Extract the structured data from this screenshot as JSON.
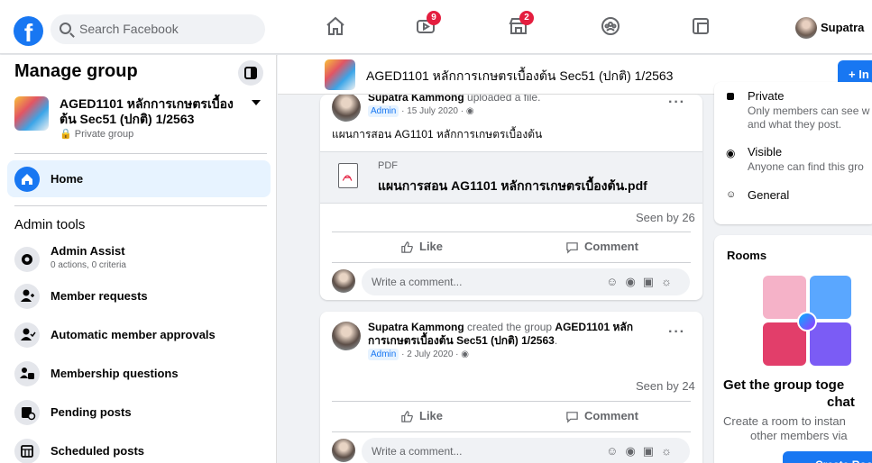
{
  "topbar": {
    "search_placeholder": "Search Facebook",
    "watch_badge": "9",
    "marketplace_badge": "2",
    "profile_name": "Supatra"
  },
  "sidebar": {
    "title": "Manage group",
    "group_name": "AGED1101 หลักการเกษตรเบื้องต้น Sec51 (ปกติ) 1/2563",
    "group_privacy": "Private group",
    "home_label": "Home",
    "section_title": "Admin tools",
    "items": [
      {
        "label": "Admin Assist",
        "sub": "0 actions, 0 criteria"
      },
      {
        "label": "Member requests"
      },
      {
        "label": "Automatic member approvals"
      },
      {
        "label": "Membership questions"
      },
      {
        "label": "Pending posts"
      },
      {
        "label": "Scheduled posts"
      }
    ]
  },
  "group_header": {
    "title": "AGED1101 หลักการเกษตรเบื้องต้น Sec51 (ปกติ) 1/2563",
    "invite_label": "+ In"
  },
  "post1": {
    "author": "Supatra Kammong",
    "action": " uploaded a file.",
    "role": "Admin",
    "date": "· 15 July 2020 · ",
    "text": "แผนการสอน AG1101 หลักการเกษตรเบื้องต้น",
    "file_type": "PDF",
    "file_name": "แผนการสอน AG1101 หลักการเกษตรเบื้องต้น.pdf",
    "seen": "Seen by 26",
    "like": "Like",
    "comment": "Comment",
    "comment_placeholder": "Write a comment..."
  },
  "post2": {
    "author": "Supatra Kammong",
    "action": " created the group ",
    "group_line1": "AGED1101 หลัก",
    "group_line2": "การเกษตรเบื้องต้น Sec51 (ปกติ) 1/2563",
    "role": "Admin",
    "date": "· 2 July 2020 · ",
    "seen": "Seen by 24",
    "like": "Like",
    "comment": "Comment",
    "comment_placeholder": "Write a comment..."
  },
  "about": {
    "private_title": "Private",
    "private_sub1": "Only members can see w",
    "private_sub2": "and what they post.",
    "visible_title": "Visible",
    "visible_sub": "Anyone can find this gro",
    "general": "General"
  },
  "rooms": {
    "title": "Rooms",
    "headline1": "Get the group toge",
    "headline2": "chat",
    "desc1": "Create a room to instan",
    "desc2": "other members via",
    "button": "Create Roo"
  },
  "colors": {
    "accent": "#1877f2",
    "badge": "#e41e3f",
    "bg": "#f0f2f5"
  }
}
